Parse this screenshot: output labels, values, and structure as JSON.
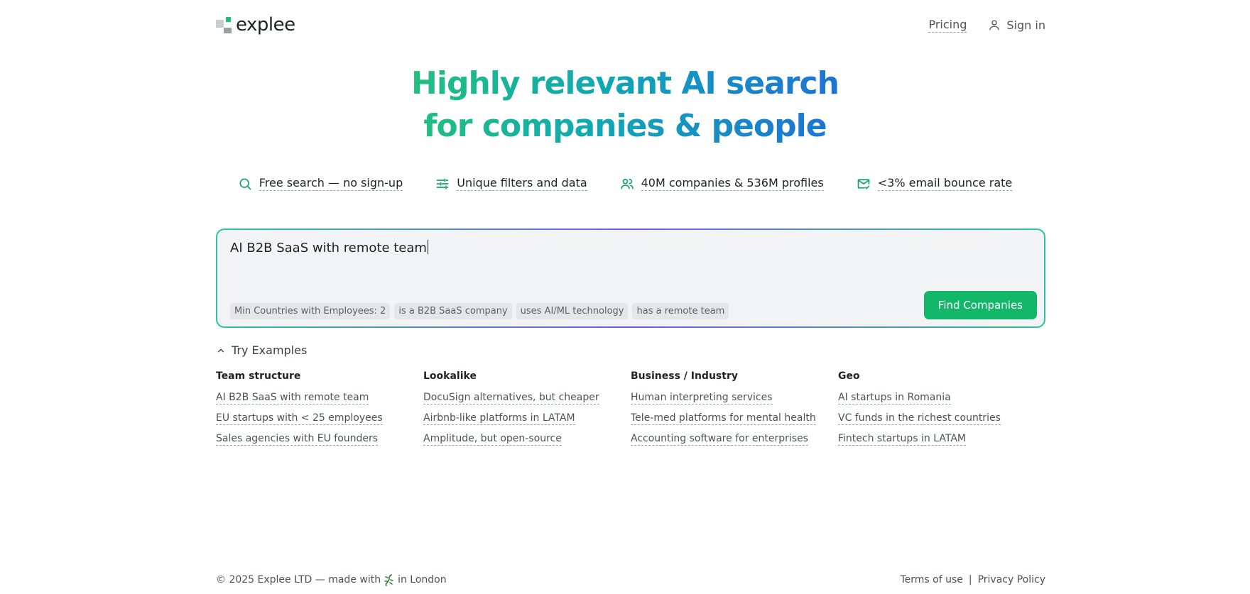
{
  "header": {
    "logo_text": "explee",
    "nav": {
      "pricing": "Pricing",
      "sign_in": "Sign in"
    }
  },
  "hero": {
    "line1": "Highly relevant AI search",
    "line2": "for companies & people"
  },
  "features": [
    {
      "icon": "search-icon",
      "label": "Free search — no sign-up"
    },
    {
      "icon": "sliders-icon",
      "label": "Unique filters and data"
    },
    {
      "icon": "users-icon",
      "label": "40M companies & 536M profiles"
    },
    {
      "icon": "mail-check-icon",
      "label": "<3% email bounce rate"
    }
  ],
  "search": {
    "value": "AI B2B SaaS with remote team",
    "chips": [
      "Min Countries with Employees: 2",
      "is a B2B SaaS company",
      "uses AI/ML technology",
      "has a remote team"
    ],
    "button": "Find Companies"
  },
  "examples": {
    "toggle": "Try Examples",
    "columns": [
      {
        "title": "Team structure",
        "items": [
          "AI B2B SaaS with remote team",
          "EU startups with < 25 employees",
          "Sales agencies with EU founders"
        ]
      },
      {
        "title": "Lookalike",
        "items": [
          "DocuSign alternatives, but cheaper",
          "Airbnb-like platforms in LATAM",
          "Amplitude, but open-source"
        ]
      },
      {
        "title": "Business / Industry",
        "items": [
          "Human interpreting services",
          "Tele-med platforms for mental health",
          "Accounting software for enterprises"
        ]
      },
      {
        "title": "Geo",
        "items": [
          "AI startups in Romania",
          "VC funds in the richest countries",
          "Fintech startups in LATAM"
        ]
      }
    ]
  },
  "footer": {
    "copyright": "© 2025 Explee LTD — made with",
    "location": "in London",
    "terms": "Terms of use",
    "separator": "|",
    "privacy": "Privacy Policy"
  },
  "colors": {
    "accent_green": "#12b76a",
    "gradient_start": "#22c07e",
    "gradient_end": "#1e72d6"
  }
}
